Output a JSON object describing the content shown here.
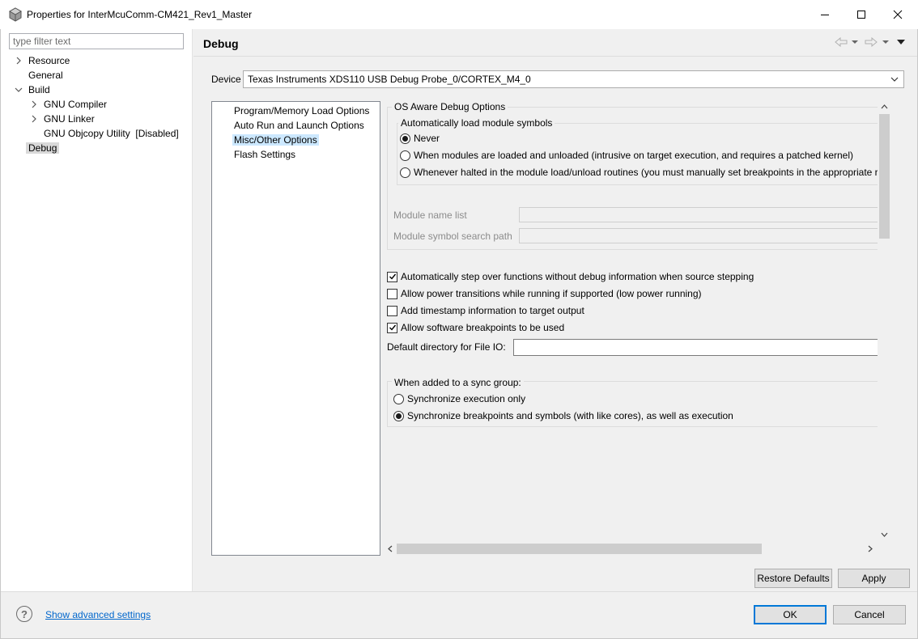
{
  "window": {
    "title": "Properties for InterMcuComm-CM421_Rev1_Master"
  },
  "filter": {
    "placeholder": "type filter text"
  },
  "tree": {
    "resource": "Resource",
    "general": "General",
    "build": "Build",
    "gnu_compiler": "GNU Compiler",
    "gnu_linker": "GNU Linker",
    "gnu_objcopy": "GNU Objcopy Utility  [Disabled]",
    "debug": "Debug"
  },
  "page": {
    "title": "Debug"
  },
  "device": {
    "label": "Device",
    "value": "Texas Instruments XDS110 USB Debug Probe_0/CORTEX_M4_0"
  },
  "categories": [
    "Program/Memory Load Options",
    "Auto Run and Launch Options",
    "Misc/Other Options",
    "Flash Settings"
  ],
  "os_aware": {
    "title": "OS Aware Debug Options",
    "auto_load": {
      "title": "Automatically load module symbols",
      "options": [
        "Never",
        "When modules are loaded and unloaded (intrusive on target execution, and requires a patched kernel)",
        "Whenever halted in the module load/unload routines (you must manually set breakpoints in the appropriate r"
      ],
      "selected": "Never"
    },
    "module_name_list_label": "Module name list",
    "module_symbol_path_label": "Module symbol search path"
  },
  "checkboxes": [
    {
      "label": "Automatically step over functions without debug information when source stepping",
      "checked": true
    },
    {
      "label": "Allow power transitions while running if supported (low power running)",
      "checked": false
    },
    {
      "label": "Add timestamp information to target output",
      "checked": false
    },
    {
      "label": "Allow software breakpoints to be used",
      "checked": true
    }
  ],
  "file_io": {
    "label": "Default directory for File IO:",
    "value": ""
  },
  "sync_group": {
    "title": "When added to a sync group:",
    "options": [
      "Synchronize execution only",
      "Synchronize breakpoints and symbols (with like cores), as well as execution"
    ],
    "selected": "Synchronize breakpoints and symbols (with like cores), as well as execution"
  },
  "buttons": {
    "restore_defaults": "Restore Defaults",
    "apply": "Apply",
    "ok": "OK",
    "cancel": "Cancel"
  },
  "footer": {
    "help_symbol": "?",
    "advanced_link": "Show advanced settings"
  },
  "colors": {
    "selection": "#cce8ff",
    "link": "#0066cc",
    "default_button_border": "#0078d7"
  }
}
